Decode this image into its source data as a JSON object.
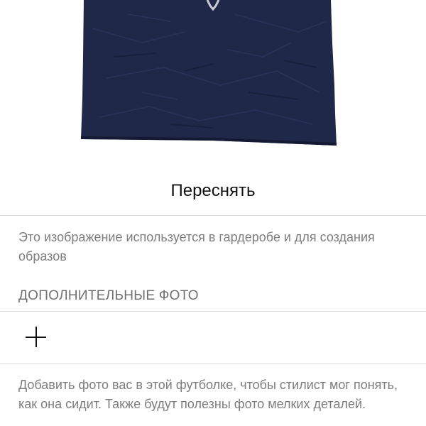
{
  "photo": {
    "subject": "navy t-shirt photo",
    "color": "#1f2849"
  },
  "retake_label": "Переснять",
  "image_note": "Это изображение используется в гардеробе и для создания образов",
  "additional_photos": {
    "header": "ДОПОЛНИТЕЛЬНЫЕ ФОТО",
    "add_icon": "plus-icon",
    "hint": "Добавить фото вас в этой футболке, чтобы стилист мог понять, как она сидит. Также будут полезны фото мелких деталей."
  },
  "colors": {
    "text_primary": "#111111",
    "text_secondary": "#7d7d7d",
    "divider": "#d9d9d9"
  }
}
